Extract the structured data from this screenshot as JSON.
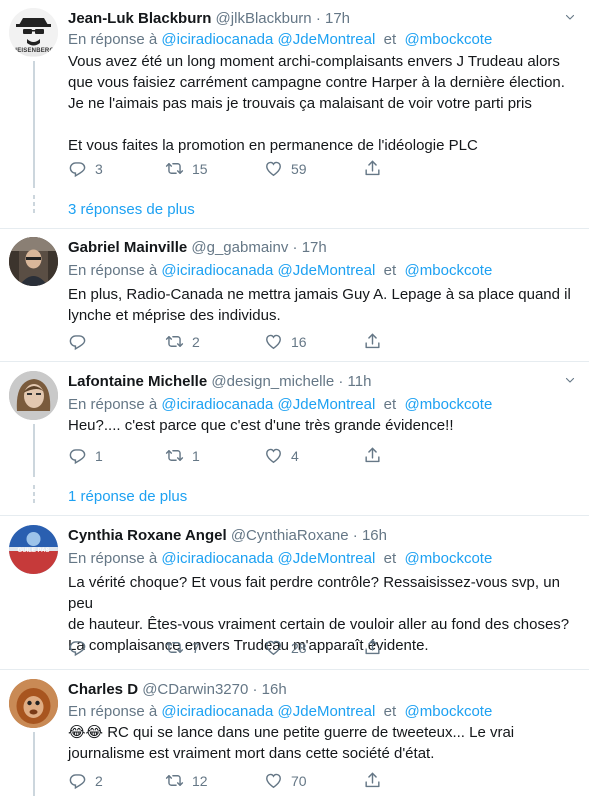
{
  "reply_prefix": "En réponse à",
  "and_word": "et",
  "mentions": [
    "@iciradiocanada",
    "@JdeMontreal",
    "@mbockcote"
  ],
  "tweets": [
    {
      "name": "Jean-Luk Blackburn",
      "handle": "@jlkBlackburn",
      "time": "17h",
      "avatar_text": "HEISENBERG",
      "body": [
        "Vous avez été un long moment archi-complaisants envers J Trudeau alors",
        "que vous faisiez carrément campagne contre Harper à la dernière élection.",
        "Je ne l'aimais pas mais je trouvais ça malaisant de voir votre parti pris",
        "Et vous faites la promotion en permanence de l'idéologie PLC"
      ],
      "replies": "3",
      "retweets": "15",
      "likes": "59"
    },
    {
      "name": "Gabriel Mainville",
      "handle": "@g_gabmainv",
      "time": "17h",
      "body": [
        "En plus, Radio-Canada ne mettra jamais Guy A. Lepage à sa place quand il",
        "lynche et méprise des individus."
      ],
      "replies": "",
      "retweets": "2",
      "likes": "16"
    },
    {
      "name": "Lafontaine Michelle",
      "handle": "@design_michelle",
      "time": "11h",
      "body": [
        "Heu?.... c'est parce que c'est d'une très grande évidence!!"
      ],
      "replies": "1",
      "retweets": "1",
      "likes": "4"
    },
    {
      "name": "Cynthia Roxane Angel",
      "handle": "@CynthiaRoxane",
      "time": "16h",
      "avatar_text": "GUILE PAS",
      "body": [
        "La vérité choque? Et vous fait perdre contrôle? Ressaisissez-vous svp, un peu",
        "de hauteur. Êtes-vous vraiment certain de vouloir aller au fond des choses?",
        "La complaisance envers Trudeau m'apparaît évidente."
      ],
      "replies": "",
      "retweets": "7",
      "likes": "28"
    },
    {
      "name": "Charles D",
      "handle": "@CDarwin3270",
      "time": "16h",
      "body": [
        "😂😂 RC qui se lance dans une petite guerre de tweeteux... Le vrai",
        "journalisme est vraiment mort dans cette société d'état."
      ],
      "replies": "2",
      "retweets": "12",
      "likes": "70"
    }
  ],
  "show_more": [
    "3 réponses de plus",
    "1 réponse de plus"
  ],
  "colors": {
    "link": "#1da1f2",
    "secondary": "#657786",
    "divider": "#e6ecf0",
    "thread": "#ccd6dd"
  },
  "icons": [
    "reply-icon",
    "retweet-icon",
    "like-icon",
    "share-icon",
    "chevron-down-icon"
  ]
}
